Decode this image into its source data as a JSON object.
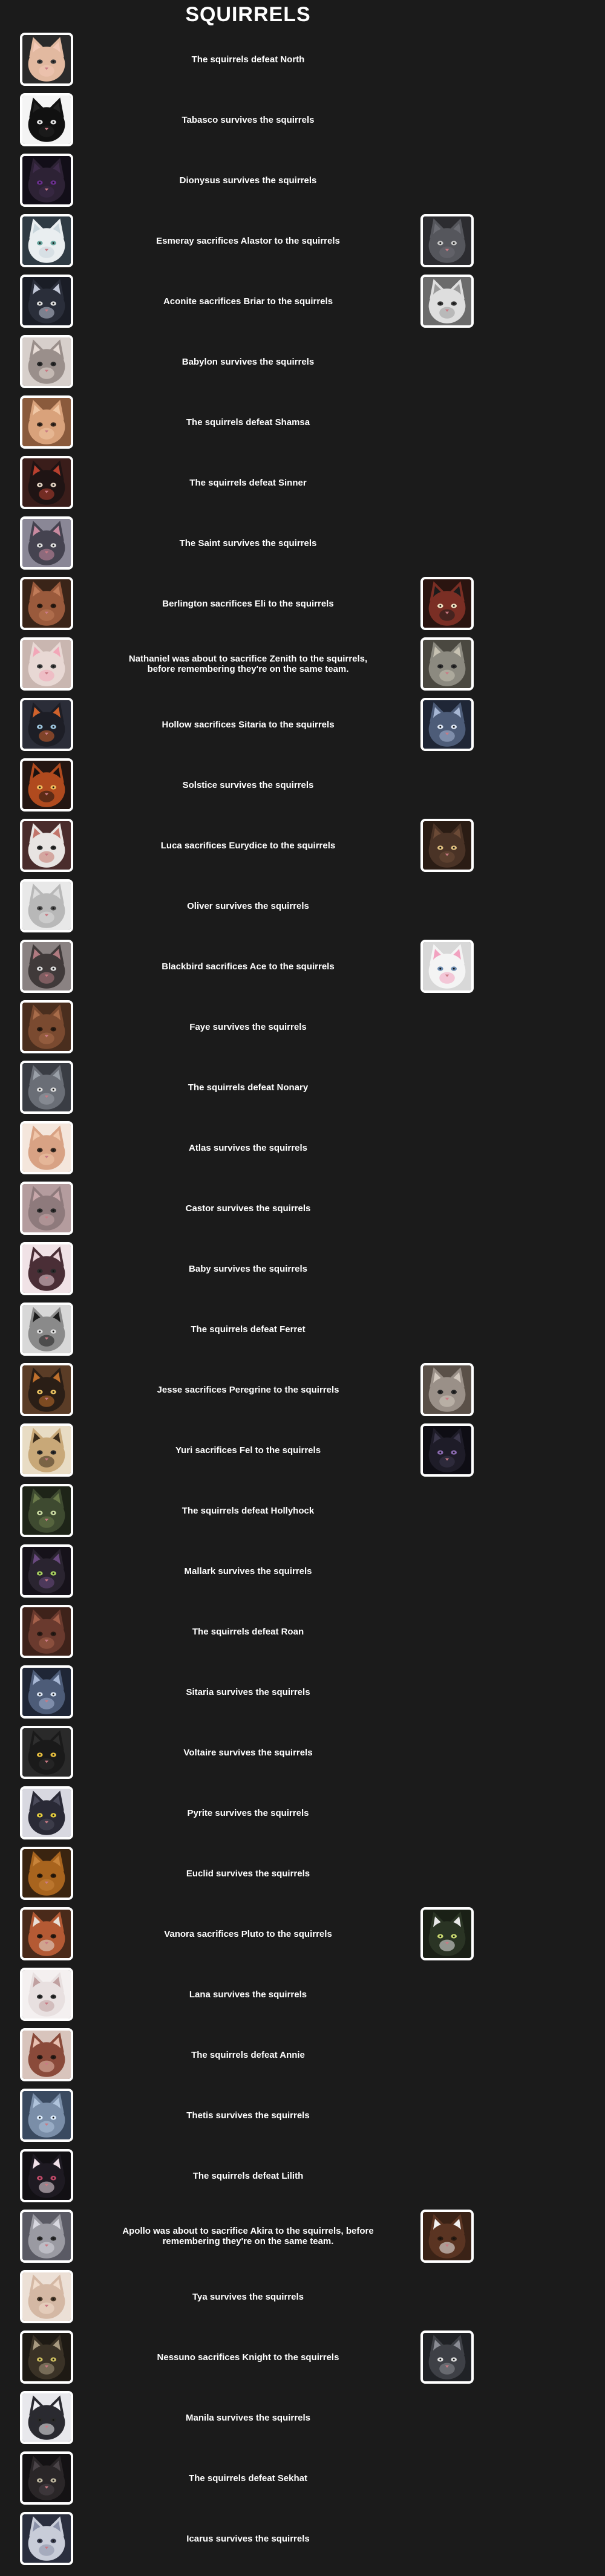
{
  "page": {
    "title": "SQUIRRELS",
    "background": "#1b1b1b"
  },
  "rows": [
    {
      "text": "The squirrels defeat North",
      "left": {
        "name": "North",
        "fur": "#e2b9a0",
        "ear": "#f2c8b6",
        "eye": "#3b3b3b",
        "bg": "#2a2a2a"
      }
    },
    {
      "text": "Tabasco survives the squirrels",
      "left": {
        "name": "Tabasco",
        "fur": "#111111",
        "ear": "#222222",
        "eye": "#e8e8e8",
        "bg": "#f4f4f4"
      }
    },
    {
      "text": "Dionysus survives the squirrels",
      "left": {
        "name": "Dionysus",
        "fur": "#2d2235",
        "ear": "#3e2c4a",
        "eye": "#6b2f8f",
        "bg": "#120e18"
      }
    },
    {
      "text": "Esmeray sacrifices Alastor to the squirrels",
      "left": {
        "name": "Esmeray",
        "fur": "#e9eef0",
        "ear": "#c9d6dc",
        "eye": "#6aa7a0",
        "bg": "#2f3b44"
      },
      "right": {
        "name": "Alastor",
        "fur": "#55565c",
        "ear": "#6b6c73",
        "eye": "#c8c8c8",
        "bg": "#2c2c30"
      }
    },
    {
      "text": "Aconite sacrifices Briar to the squirrels",
      "left": {
        "name": "Aconite",
        "fur": "#2a2e3a",
        "ear": "#c0c6d6",
        "eye": "#e0e0e0",
        "bg": "#1a1d26"
      },
      "right": {
        "name": "Briar",
        "fur": "#dedede",
        "ear": "#9a9a9a",
        "eye": "#333333",
        "bg": "#6b6b6b"
      }
    },
    {
      "text": "Babylon survives the squirrels",
      "left": {
        "name": "Babylon",
        "fur": "#9a8f8b",
        "ear": "#e7dcd6",
        "eye": "#2b2b2b",
        "bg": "#d7cfcb"
      }
    },
    {
      "text": "The squirrels defeat Shamsa",
      "left": {
        "name": "Shamsa",
        "fur": "#d9a27b",
        "ear": "#f0c7a5",
        "eye": "#3a2a20",
        "bg": "#8a5a3c"
      }
    },
    {
      "text": "The squirrels defeat Sinner",
      "left": {
        "name": "Sinner",
        "fur": "#1f1414",
        "ear": "#b8402f",
        "eye": "#e0d0c0",
        "bg": "#3a1d1a"
      }
    },
    {
      "text": "The Saint survives the squirrels",
      "left": {
        "name": "The Saint",
        "fur": "#454350",
        "ear": "#c98aa0",
        "eye": "#e2e2e2",
        "bg": "#8a8796"
      }
    },
    {
      "text": "Berlington sacrifices Eli to the squirrels",
      "left": {
        "name": "Berlington",
        "fur": "#9a5a3c",
        "ear": "#c07b58",
        "eye": "#2a1a10",
        "bg": "#3a2418"
      },
      "right": {
        "name": "Eli",
        "fur": "#7a2e24",
        "ear": "#1c1c1c",
        "eye": "#f0e0c0",
        "bg": "#2a1410"
      }
    },
    {
      "text": "Nathaniel was about to sacrifice Zenith to the squirrels, before remembering they're on the same team.",
      "left": {
        "name": "Nathaniel",
        "fur": "#e8d8d4",
        "ear": "#f2a7b8",
        "eye": "#3b3b3b",
        "bg": "#c9b6b0"
      },
      "right": {
        "name": "Zenith",
        "fur": "#8c8a80",
        "ear": "#c7c2b2",
        "eye": "#2a2a2a",
        "bg": "#4a4840"
      }
    },
    {
      "text": "Hollow sacrifices Sitaria to the squirrels",
      "left": {
        "name": "Hollow",
        "fur": "#1d1e26",
        "ear": "#d0622c",
        "eye": "#9ec6e0",
        "bg": "#2b2d38"
      },
      "right": {
        "name": "Sitaria",
        "fur": "#4d5c78",
        "ear": "#a7b7d4",
        "eye": "#dfe8f5",
        "bg": "#1f2636"
      }
    },
    {
      "text": "Solstice survives the squirrels",
      "left": {
        "name": "Solstice",
        "fur": "#b04a1e",
        "ear": "#1a1210",
        "eye": "#f2c060",
        "bg": "#241612"
      }
    },
    {
      "text": "Luca sacrifices Eurydice to the squirrels",
      "left": {
        "name": "Luca",
        "fur": "#e8e4e2",
        "ear": "#c2746a",
        "eye": "#2b2b2b",
        "bg": "#4a2c2c"
      },
      "right": {
        "name": "Eurydice",
        "fur": "#4a3326",
        "ear": "#6b4a36",
        "eye": "#e0c080",
        "bg": "#2a1c14"
      }
    },
    {
      "text": "Oliver survives the squirrels",
      "left": {
        "name": "Oliver",
        "fur": "#b8b8b8",
        "ear": "#dcdcdc",
        "eye": "#4a4a4a",
        "bg": "#e8e8e8"
      }
    },
    {
      "text": "Blackbird sacrifices Ace to the squirrels",
      "left": {
        "name": "Blackbird",
        "fur": "#403a3a",
        "ear": "#b07a80",
        "eye": "#e0e0e0",
        "bg": "#8a8282"
      },
      "right": {
        "name": "Ace",
        "fur": "#f4f4f4",
        "ear": "#f2a2c0",
        "eye": "#6b8bb0",
        "bg": "#d8d8d8"
      }
    },
    {
      "text": "Faye survives the squirrels",
      "left": {
        "name": "Faye",
        "fur": "#7a4a30",
        "ear": "#a86c4a",
        "eye": "#2a1a10",
        "bg": "#4a2e1e"
      }
    },
    {
      "text": "The squirrels defeat Nonary",
      "left": {
        "name": "Nonary",
        "fur": "#6a6e76",
        "ear": "#9aa0a8",
        "eye": "#e0e0e0",
        "bg": "#3a3d44"
      }
    },
    {
      "text": "Atlas survives the squirrels",
      "left": {
        "name": "Atlas",
        "fur": "#d8a284",
        "ear": "#f0c6aa",
        "eye": "#3a2a20",
        "bg": "#f4e6dc"
      }
    },
    {
      "text": "Castor survives the squirrels",
      "left": {
        "name": "Castor",
        "fur": "#8e7a7c",
        "ear": "#c7a7aa",
        "eye": "#2b2b2b",
        "bg": "#b49c9e"
      }
    },
    {
      "text": "Baby survives the squirrels",
      "left": {
        "name": "Baby",
        "fur": "#4a2e36",
        "ear": "#e9d2d8",
        "eye": "#2b2b2b",
        "bg": "#f0e2e6"
      }
    },
    {
      "text": "The squirrels defeat Ferret",
      "left": {
        "name": "Ferret",
        "fur": "#8a8a8a",
        "ear": "#1c1c1c",
        "eye": "#e0e0e0",
        "bg": "#d8d8d8"
      }
    },
    {
      "text": "Jesse sacrifices Peregrine to the squirrels",
      "left": {
        "name": "Jesse",
        "fur": "#2a1e16",
        "ear": "#c0702c",
        "eye": "#e8c060",
        "bg": "#5a3c26"
      },
      "right": {
        "name": "Peregrine",
        "fur": "#9a9088",
        "ear": "#d2c8be",
        "eye": "#2a2a2a",
        "bg": "#5a5048"
      }
    },
    {
      "text": "Yuri sacrifices Fel to the squirrels",
      "left": {
        "name": "Yuri",
        "fur": "#c8a878",
        "ear": "#3a2c1c",
        "eye": "#2a2a2a",
        "bg": "#e8dcc4"
      },
      "right": {
        "name": "Fel",
        "fur": "#1e1c28",
        "ear": "#3a364a",
        "eye": "#8a6ab0",
        "bg": "#0e0d14"
      }
    },
    {
      "text": "The squirrels defeat Hollyhock",
      "left": {
        "name": "Hollyhock",
        "fur": "#3e4a30",
        "ear": "#6a7a4a",
        "eye": "#c8d8a0",
        "bg": "#1e2418"
      }
    },
    {
      "text": "Mallark survives the squirrels",
      "left": {
        "name": "Mallark",
        "fur": "#2a2430",
        "ear": "#6a4a80",
        "eye": "#a8d060",
        "bg": "#16121a"
      }
    },
    {
      "text": "The squirrels defeat Roan",
      "left": {
        "name": "Roan",
        "fur": "#6a3a2e",
        "ear": "#a4604a",
        "eye": "#2a1a14",
        "bg": "#3e221a"
      }
    },
    {
      "text": "Sitaria survives the squirrels",
      "left": {
        "name": "Sitaria",
        "fur": "#4d5c78",
        "ear": "#a7b7d4",
        "eye": "#dfe8f5",
        "bg": "#1f2636"
      }
    },
    {
      "text": "Voltaire survives the squirrels",
      "left": {
        "name": "Voltaire",
        "fur": "#1a1a1a",
        "ear": "#2e2e2e",
        "eye": "#e8c040",
        "bg": "#2a2a2a"
      }
    },
    {
      "text": "Pyrite survives the squirrels",
      "left": {
        "name": "Pyrite",
        "fur": "#2a2a36",
        "ear": "#4a4a5a",
        "eye": "#e8d040",
        "bg": "#d8d8e0"
      }
    },
    {
      "text": "Euclid survives the squirrels",
      "left": {
        "name": "Euclid",
        "fur": "#a8641e",
        "ear": "#c8843a",
        "eye": "#2a1a0a",
        "bg": "#3a2410"
      }
    },
    {
      "text": "Vanora sacrifices Pluto to the squirrels",
      "left": {
        "name": "Vanora",
        "fur": "#b45a34",
        "ear": "#e8e0d8",
        "eye": "#2a1a10",
        "bg": "#4a2a1a"
      },
      "right": {
        "name": "Pluto",
        "fur": "#2a3424",
        "ear": "#e8e8e8",
        "eye": "#c8d870",
        "bg": "#1a2016"
      }
    },
    {
      "text": "Lana survives the squirrels",
      "left": {
        "name": "Lana",
        "fur": "#e8e0e0",
        "ear": "#c0a0a0",
        "eye": "#2b2b2b",
        "bg": "#f4f0f0"
      }
    },
    {
      "text": "The squirrels defeat Annie",
      "left": {
        "name": "Annie",
        "fur": "#8a4a3a",
        "ear": "#e8c0b0",
        "eye": "#2a1a14",
        "bg": "#d8c4bc"
      }
    },
    {
      "text": "Thetis survives the squirrels",
      "left": {
        "name": "Thetis",
        "fur": "#7a8ea8",
        "ear": "#b0c4dc",
        "eye": "#e0f0ff",
        "bg": "#3a4a60"
      }
    },
    {
      "text": "The squirrels defeat Lilith",
      "left": {
        "name": "Lilith",
        "fur": "#1e1a22",
        "ear": "#f0e0e8",
        "eye": "#c04a6a",
        "bg": "#121014"
      }
    },
    {
      "text": "Apollo was about to sacrifice Akira to the squirrels, before remembering they're on the same team.",
      "left": {
        "name": "Apollo",
        "fur": "#9a9aa2",
        "ear": "#d8d8e0",
        "eye": "#2a2a2a",
        "bg": "#5a5a64"
      },
      "right": {
        "name": "Akira",
        "fur": "#5a3422",
        "ear": "#f2f2f2",
        "eye": "#2a1a10",
        "bg": "#3a2216"
      }
    },
    {
      "text": "Tya survives the squirrels",
      "left": {
        "name": "Tya",
        "fur": "#d4b8a4",
        "ear": "#f0dccc",
        "eye": "#4a3a2a",
        "bg": "#ece0d6"
      }
    },
    {
      "text": "Nessuno sacrifices Knight to the squirrels",
      "left": {
        "name": "Nessuno",
        "fur": "#3a3226",
        "ear": "#a89a80",
        "eye": "#d0c060",
        "bg": "#1e1a14"
      },
      "right": {
        "name": "Knight",
        "fur": "#3e4046",
        "ear": "#8a8c94",
        "eye": "#e0e0e0",
        "bg": "#202226"
      }
    },
    {
      "text": "Manila survives the squirrels",
      "left": {
        "name": "Manila",
        "fur": "#2a2a30",
        "ear": "#f0f0f4",
        "eye": "#2a2a2a",
        "bg": "#e8e8ec"
      }
    },
    {
      "text": "The squirrels defeat Sekhat",
      "left": {
        "name": "Sekhat",
        "fur": "#2a2628",
        "ear": "#4a4448",
        "eye": "#c0b8a0",
        "bg": "#141214"
      }
    },
    {
      "text": "Icarus survives the squirrels",
      "left": {
        "name": "Icarus",
        "fur": "#c8ccd8",
        "ear": "#8a90a8",
        "eye": "#3a3e50",
        "bg": "#2a2e3e"
      }
    }
  ]
}
